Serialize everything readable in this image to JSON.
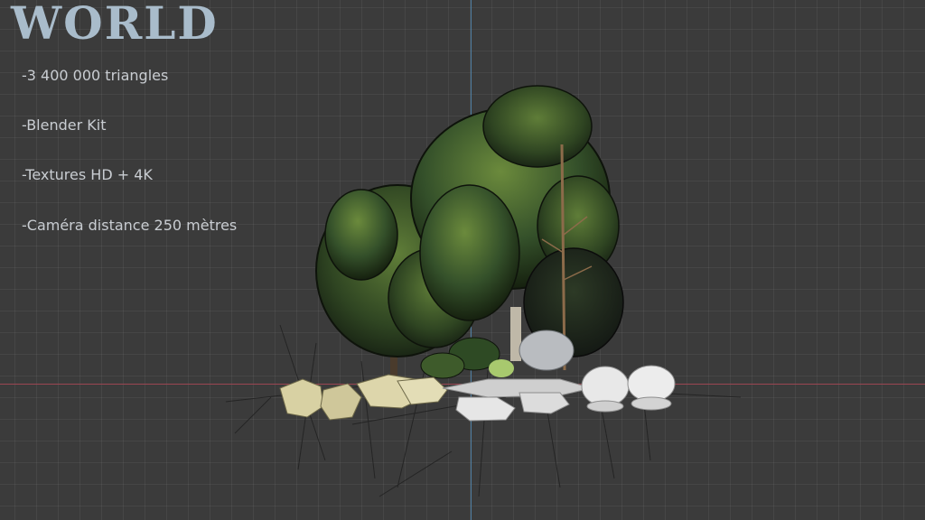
{
  "title": "WORLD",
  "specs": {
    "triangles": "-3 400 000 triangles",
    "source": "-Blender Kit",
    "textures": "-Textures HD + 4K",
    "camera": "-Caméra distance 250 mètres"
  },
  "colors": {
    "viewport_bg": "#3b3b3b",
    "title": "#a9bccb",
    "x_axis": "#9a4652",
    "y_axis": "#4e7fa3",
    "foliage": "#3f5a2c",
    "rock_yellow": "#d9d2a6",
    "rock_white": "#e6e6e6"
  },
  "scene": {
    "icon": "forest-island-render"
  }
}
